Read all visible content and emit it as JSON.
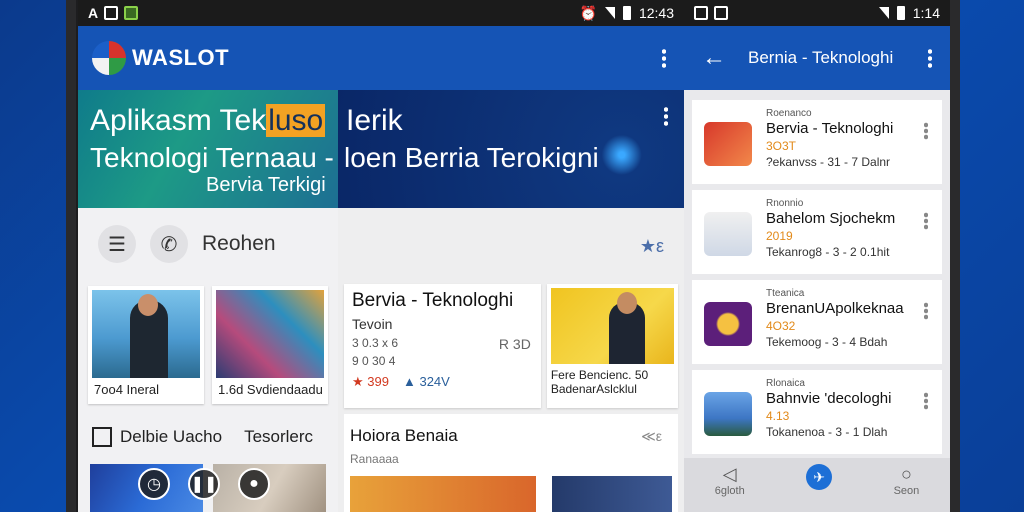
{
  "status_left": {
    "icons": [
      "signal-a-icon",
      "settings-icon",
      "app-badge-icon"
    ]
  },
  "status_mid": {
    "time": "12:43"
  },
  "status_right": {
    "time": "1:14"
  },
  "screen1": {
    "brand": "WASLOT",
    "hero": {
      "line1_a": "Aplikasm Tek",
      "line1_hl": "luso",
      "line2": "Teknologi Ternaau  -",
      "line3": "Bervia Terkigi"
    },
    "search_label": "Reohen",
    "cards": [
      {
        "caption": "7oo4 Ineral"
      },
      {
        "caption": "1.6d Svdiendaadu"
      }
    ],
    "section_title": "Delbie Uacho",
    "section_sub": "Tesorlerc"
  },
  "screen2": {
    "hero": {
      "line1": "Ierik",
      "line2": "loen Berria Terokigni"
    },
    "featured": {
      "title": "Bervia - Teknologhi",
      "sub": "Tevoin",
      "meta1": "3 0.3 x 6",
      "meta2": "9 0 30 4",
      "price": "399",
      "count": "324V",
      "right": "R 3D"
    },
    "side_card": {
      "caption_line1": "Fere Bencienc. 50",
      "caption_line2": "BadenarAslcklul"
    },
    "section": {
      "title": "Hoiora Benaia",
      "sub": "Ranaaaa"
    }
  },
  "screen3": {
    "title": "Bernia - Teknologhi",
    "items": [
      {
        "small": "Roenanco",
        "name": "Bervia - Teknologhi",
        "year": "3O3T",
        "meta": "?ekanvss  -  31  -  7 Dalnr"
      },
      {
        "small": "Rnonnio",
        "name": "Bahelom Sjochekm",
        "year": "2019",
        "meta": "Tekanrog8  -  3  -  2 0.1hit"
      },
      {
        "small": "Tteanica",
        "name": "BrenanUApolkeknaa",
        "year": "4O32",
        "meta": "Tekemoog  -  3  -  4 Bdah"
      },
      {
        "small": "Rlonaica",
        "name": "Bahnvie 'decologhi",
        "year": "4.13",
        "meta": "Tokanenoa  -  3  -  1 Dlah"
      }
    ],
    "nav": [
      {
        "label": "6gloth"
      },
      {
        "label": ""
      },
      {
        "label": "Seon"
      }
    ]
  }
}
